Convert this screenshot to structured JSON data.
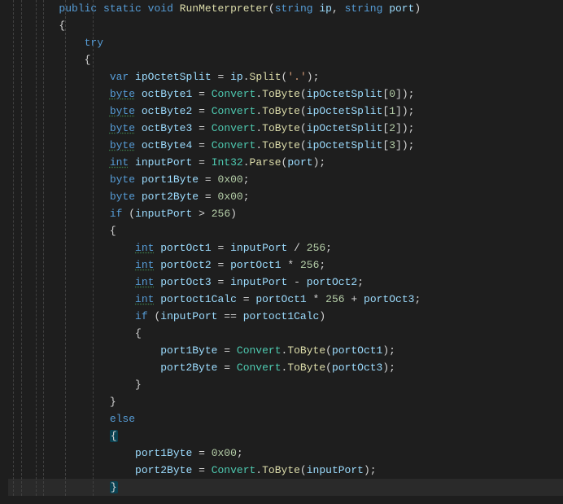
{
  "tokens": {
    "public": "public",
    "static": "static",
    "void": "void",
    "string": "string",
    "try": "try",
    "var": "var",
    "byte": "byte",
    "int": "int",
    "if": "if",
    "else": "else"
  },
  "types": {
    "Convert": "Convert",
    "Int32": "Int32"
  },
  "fns": {
    "RunMeterpreter": "RunMeterpreter",
    "Split": "Split",
    "ToByte": "ToByte",
    "Parse": "Parse"
  },
  "vars": {
    "ip": "ip",
    "port": "port",
    "ipOctetSplit": "ipOctetSplit",
    "octByte1": "octByte1",
    "octByte2": "octByte2",
    "octByte3": "octByte3",
    "octByte4": "octByte4",
    "inputPort": "inputPort",
    "port1Byte": "port1Byte",
    "port2Byte": "port2Byte",
    "portOct1": "portOct1",
    "portOct2": "portOct2",
    "portOct3": "portOct3",
    "portoct1Calc": "portoct1Calc"
  },
  "lits": {
    "dot": "'.'",
    "n0": "0",
    "n1": "1",
    "n2": "2",
    "n3": "3",
    "hex00": "0x00",
    "n256": "256"
  }
}
